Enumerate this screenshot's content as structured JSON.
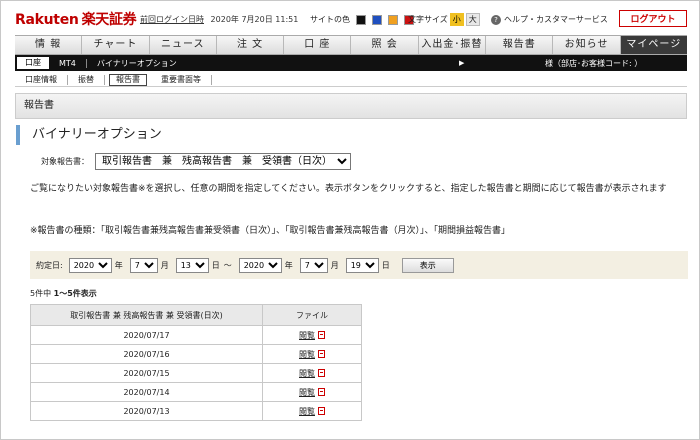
{
  "header": {
    "logo_latin": "Rakuten",
    "logo_jp": "楽天証券",
    "last_login_link": "前回ログイン日時",
    "last_login_value": "2020年 7月20日 11:51",
    "site_color_label": "サイトの色",
    "site_colors": [
      "#111111",
      "#1f4fbf",
      "#f0a020",
      "#cc1111"
    ],
    "font_size_label": "文字サイズ",
    "font_small": "小",
    "font_large": "大",
    "help_label": "ヘルプ・カスタマーサービス",
    "logout_label": "ログアウト"
  },
  "nav": [
    "情 報",
    "チャート",
    "ニュース",
    "注 文",
    "口 座",
    "照 会",
    "入出金･振替",
    "報告書",
    "お知らせ",
    "マイページ"
  ],
  "nav_active_index": 9,
  "subnav": {
    "items": [
      "口座",
      "MT4",
      "バイナリーオプション"
    ],
    "branch": "様（部店･お客様コード:                 ）"
  },
  "tnav": [
    "口座情報",
    "振替",
    "報告書",
    "重要書面等"
  ],
  "page_title": "報告書",
  "section_title": "バイナリーオプション",
  "target": {
    "label": "対象報告書：",
    "selected": "取引報告書　兼　残高報告書　兼　受領書（日次）"
  },
  "description": "ご覧になりたい対象報告書※を選択し、任意の期間を指定してください。表示ボタンをクリックすると、指定した報告書と期間に応じて報告書が表示されます",
  "note": "※報告書の種類：「取引報告書兼残高報告書兼受領書（日次）」、「取引報告書兼残高報告書（月次）」、「期間損益報告書」",
  "dateform": {
    "label": "約定日:",
    "from_year": "2020",
    "from_month": "7",
    "from_day": "13",
    "to_year": "2020",
    "to_month": "7",
    "to_day": "19",
    "year_unit": "年",
    "month_unit": "月",
    "day_unit": "日",
    "range_sep": "〜",
    "show_button": "表示"
  },
  "count": {
    "prefix": "5件中",
    "range": "1〜5件表示"
  },
  "table": {
    "headers": [
      "取引報告書 兼 残高報告書 兼 受領書(日次)",
      "ファイル"
    ],
    "view_label": "閲覧",
    "rows": [
      "2020/07/17",
      "2020/07/16",
      "2020/07/15",
      "2020/07/14",
      "2020/07/13"
    ]
  }
}
